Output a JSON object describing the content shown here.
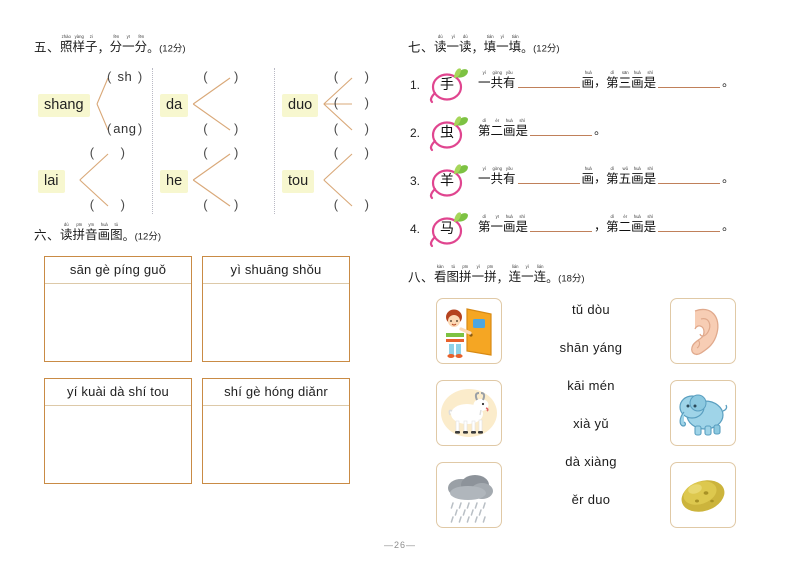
{
  "page": {
    "number": "—26—"
  },
  "ex5": {
    "num": "五、",
    "title_chars": [
      {
        "hz": "照",
        "py": "zhào"
      },
      {
        "hz": "样",
        "py": "yàng"
      },
      {
        "hz": "子",
        "py": "zi"
      }
    ],
    "comma": "，",
    "title_chars2": [
      {
        "hz": "分",
        "py": "fēn"
      },
      {
        "hz": "一",
        "py": "yī"
      },
      {
        "hz": "分",
        "py": "fēn"
      }
    ],
    "period": "。",
    "score": "(12分)",
    "items": [
      {
        "syllable": "shang",
        "branches": [
          "sh",
          "ang"
        ],
        "paren_left": "（",
        "paren_right": "）"
      },
      {
        "syllable": "da",
        "branches": [
          "",
          ""
        ],
        "paren_left": "（",
        "paren_right": "）"
      },
      {
        "syllable": "duo",
        "branches": [
          "",
          "",
          ""
        ],
        "paren_left": "（",
        "paren_right": "）"
      },
      {
        "syllable": "lai",
        "branches": [
          "",
          ""
        ],
        "paren_left": "（",
        "paren_right": "）"
      },
      {
        "syllable": "he",
        "branches": [
          "",
          ""
        ],
        "paren_left": "（",
        "paren_right": "）"
      },
      {
        "syllable": "tou",
        "branches": [
          "",
          ""
        ],
        "paren_left": "（",
        "paren_right": "）"
      }
    ]
  },
  "ex6": {
    "num": "六、",
    "title_chars": [
      {
        "hz": "读",
        "py": "dú"
      },
      {
        "hz": "拼",
        "py": "pīn"
      },
      {
        "hz": "音",
        "py": "yīn"
      },
      {
        "hz": "画",
        "py": "huà"
      },
      {
        "hz": "图",
        "py": "tú"
      }
    ],
    "period": "。",
    "score": "(12分)",
    "boxes": [
      {
        "label": "sān gè píng guǒ"
      },
      {
        "label": "yì shuāng shǒu"
      },
      {
        "label": "yí kuài dà shí tou"
      },
      {
        "label": "shí gè hóng diǎnr"
      }
    ]
  },
  "ex7": {
    "num": "七、",
    "title_chars": [
      {
        "hz": "读",
        "py": "dú"
      },
      {
        "hz": "一",
        "py": "yì"
      },
      {
        "hz": "读",
        "py": "dú"
      }
    ],
    "comma": "，",
    "title_chars2": [
      {
        "hz": "填",
        "py": "tián"
      },
      {
        "hz": "一",
        "py": "yì"
      },
      {
        "hz": "填",
        "py": "tián"
      }
    ],
    "period": "。",
    "score": "(12分)",
    "rows": [
      {
        "index": "1.",
        "char": "手",
        "parts": [
          {
            "t": "ruby",
            "chars": [
              {
                "hz": "一",
                "py": "yí"
              },
              {
                "hz": "共",
                "py": "gòng"
              },
              {
                "hz": "有",
                "py": "yǒu"
              }
            ]
          },
          {
            "t": "blank",
            "size": "lg"
          },
          {
            "t": "ruby",
            "chars": [
              {
                "hz": "画",
                "py": "huà"
              }
            ]
          },
          {
            "t": "text",
            "v": "，"
          },
          {
            "t": "ruby",
            "chars": [
              {
                "hz": "第",
                "py": "dì"
              },
              {
                "hz": "三",
                "py": "sān"
              },
              {
                "hz": "画",
                "py": "huà"
              },
              {
                "hz": "是",
                "py": "shì"
              }
            ]
          },
          {
            "t": "blank",
            "size": "lg"
          },
          {
            "t": "text",
            "v": "。"
          }
        ]
      },
      {
        "index": "2.",
        "char": "虫",
        "parts": [
          {
            "t": "ruby",
            "chars": [
              {
                "hz": "第",
                "py": "dì"
              },
              {
                "hz": "二",
                "py": "èr"
              },
              {
                "hz": "画",
                "py": "huà"
              },
              {
                "hz": "是",
                "py": "shì"
              }
            ]
          },
          {
            "t": "blank",
            "size": "lg"
          },
          {
            "t": "text",
            "v": "。"
          }
        ]
      },
      {
        "index": "3.",
        "char": "羊",
        "parts": [
          {
            "t": "ruby",
            "chars": [
              {
                "hz": "一",
                "py": "yí"
              },
              {
                "hz": "共",
                "py": "gòng"
              },
              {
                "hz": "有",
                "py": "yǒu"
              }
            ]
          },
          {
            "t": "blank",
            "size": "lg"
          },
          {
            "t": "ruby",
            "chars": [
              {
                "hz": "画",
                "py": "huà"
              }
            ]
          },
          {
            "t": "text",
            "v": "，"
          },
          {
            "t": "ruby",
            "chars": [
              {
                "hz": "第",
                "py": "dì"
              },
              {
                "hz": "五",
                "py": "wǔ"
              },
              {
                "hz": "画",
                "py": "huà"
              },
              {
                "hz": "是",
                "py": "shì"
              }
            ]
          },
          {
            "t": "blank",
            "size": "lg"
          },
          {
            "t": "text",
            "v": "。"
          }
        ]
      },
      {
        "index": "4.",
        "char": "马",
        "parts": [
          {
            "t": "ruby",
            "chars": [
              {
                "hz": "第",
                "py": "dì"
              },
              {
                "hz": "一",
                "py": "yī"
              },
              {
                "hz": "画",
                "py": "huà"
              },
              {
                "hz": "是",
                "py": "shì"
              }
            ]
          },
          {
            "t": "blank",
            "size": "lg"
          },
          {
            "t": "text",
            "v": "，"
          },
          {
            "t": "ruby",
            "chars": [
              {
                "hz": "第",
                "py": "dì"
              },
              {
                "hz": "二",
                "py": "èr"
              },
              {
                "hz": "画",
                "py": "huà"
              },
              {
                "hz": "是",
                "py": "shì"
              }
            ]
          },
          {
            "t": "blank",
            "size": "lg"
          },
          {
            "t": "text",
            "v": "。"
          }
        ]
      }
    ]
  },
  "ex8": {
    "num": "八、",
    "title_chars": [
      {
        "hz": "看",
        "py": "kàn"
      },
      {
        "hz": "图",
        "py": "tú"
      },
      {
        "hz": "拼",
        "py": "pīn"
      },
      {
        "hz": "一",
        "py": "yì"
      },
      {
        "hz": "拼",
        "py": "pīn"
      }
    ],
    "comma": "，",
    "title_chars2": [
      {
        "hz": "连",
        "py": "lián"
      },
      {
        "hz": "一",
        "py": "yì"
      },
      {
        "hz": "连",
        "py": "lián"
      }
    ],
    "period": "。",
    "score": "(18分)",
    "words": [
      "tǔ dòu",
      "shān yáng",
      "kāi mén",
      "xià yǔ",
      "dà xiàng",
      "ěr duo"
    ],
    "pictures_left": [
      "girl-opening-door-picture",
      "goat-picture",
      "rain-cloud-picture"
    ],
    "pictures_right": [
      "ear-picture",
      "elephant-picture",
      "potato-picture"
    ]
  },
  "colors": {
    "highlight": "#f7f7cf",
    "box_border": "#c98b45",
    "card_border": "#e0c9a6",
    "branch_line": "#d9a878",
    "blank_line": "#c0805a",
    "radish_pink": "#e0458f"
  }
}
